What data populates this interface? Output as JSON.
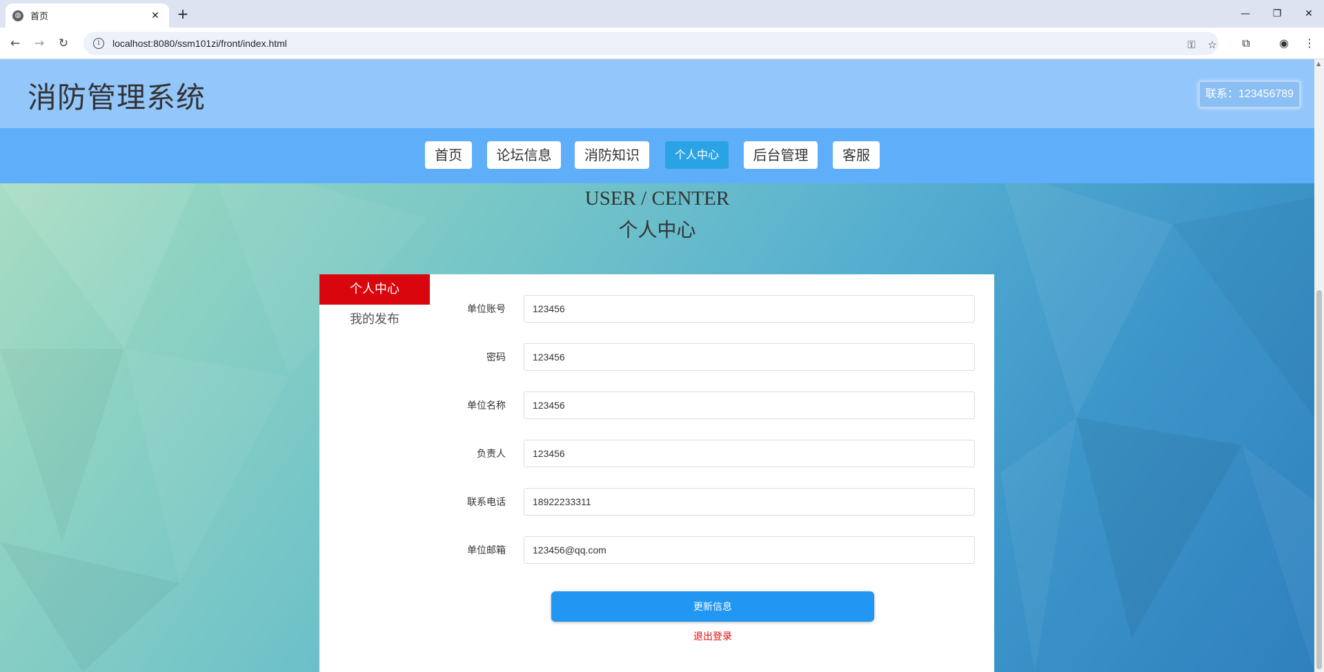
{
  "browser": {
    "tab_title": "首页",
    "url": "localhost:8080/ssm101zi/front/index.html"
  },
  "site": {
    "title": "消防管理系统",
    "contact": "联系：123456789"
  },
  "nav": {
    "items": [
      {
        "label": "首页"
      },
      {
        "label": "论坛信息"
      },
      {
        "label": "消防知识"
      },
      {
        "label": "个人中心",
        "active": true
      },
      {
        "label": "后台管理"
      },
      {
        "label": "客服"
      }
    ]
  },
  "center": {
    "title_en": "USER / CENTER",
    "title_zh": "个人中心"
  },
  "sidebar": {
    "items": [
      {
        "label": "个人中心",
        "active": true
      },
      {
        "label": "我的发布"
      }
    ]
  },
  "form": {
    "fields": [
      {
        "label": "单位账号",
        "value": "123456"
      },
      {
        "label": "密码",
        "value": "123456"
      },
      {
        "label": "单位名称",
        "value": "123456"
      },
      {
        "label": "负责人",
        "value": "123456"
      },
      {
        "label": "联系电话",
        "value": "18922233311"
      },
      {
        "label": "单位邮箱",
        "value": "123456@qq.com"
      }
    ],
    "submit_label": "更新信息",
    "logout_label": "退出登录"
  },
  "colors": {
    "header_bg": "#93c6fb",
    "nav_bg": "#5eaefa",
    "nav_active": "#2aa3e5",
    "sidebar_active": "#d9060d",
    "button": "#2196f3",
    "logout": "#e30b0b"
  }
}
